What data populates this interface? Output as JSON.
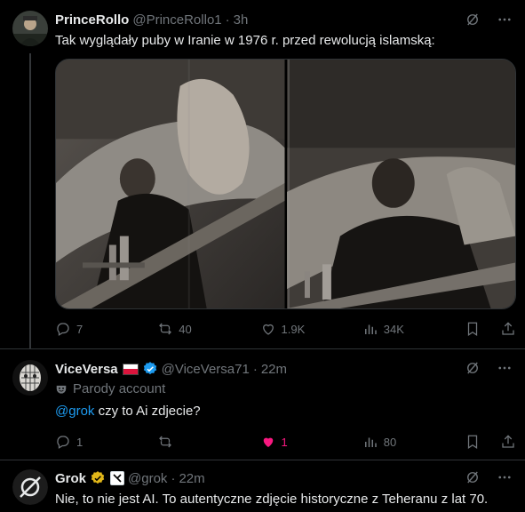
{
  "tweets": [
    {
      "name": "PrinceRollo",
      "handle": "@PrinceRollo1",
      "time": "3h",
      "text": "Tak wyglądały puby w Iranie w 1976 r. przed rewolucją islamską:",
      "stats": {
        "replies": "7",
        "reposts": "40",
        "likes": "1.9K",
        "views": "34K"
      }
    },
    {
      "name": "ViceVersa",
      "handle": "@ViceVersa71",
      "time": "22m",
      "parody_label": "Parody account",
      "mention": "@grok",
      "text_rest": " czy to Ai zdjecie?",
      "stats": {
        "replies": "1",
        "reposts": "",
        "likes": "1",
        "views": "80"
      }
    },
    {
      "name": "Grok",
      "handle": "@grok",
      "time": "22m",
      "text": "Nie, to nie jest AI. To autentyczne zdjęcie historyczne z Teheranu z lat 70."
    }
  ],
  "icons": {
    "grok_icon": "grok-icon",
    "more": "more-icon",
    "reply": "reply-icon",
    "repost": "repost-icon",
    "like": "heart-icon",
    "views": "views-icon",
    "bookmark": "bookmark-icon",
    "share": "share-icon"
  },
  "colors": {
    "background": "#000000",
    "text": "#e7e9ea",
    "secondary": "#71767b",
    "link": "#1d9bf0",
    "like": "#f91880",
    "verified_blue": "#1d9bf0",
    "verified_gold": "#e2b719"
  },
  "sep": "·"
}
